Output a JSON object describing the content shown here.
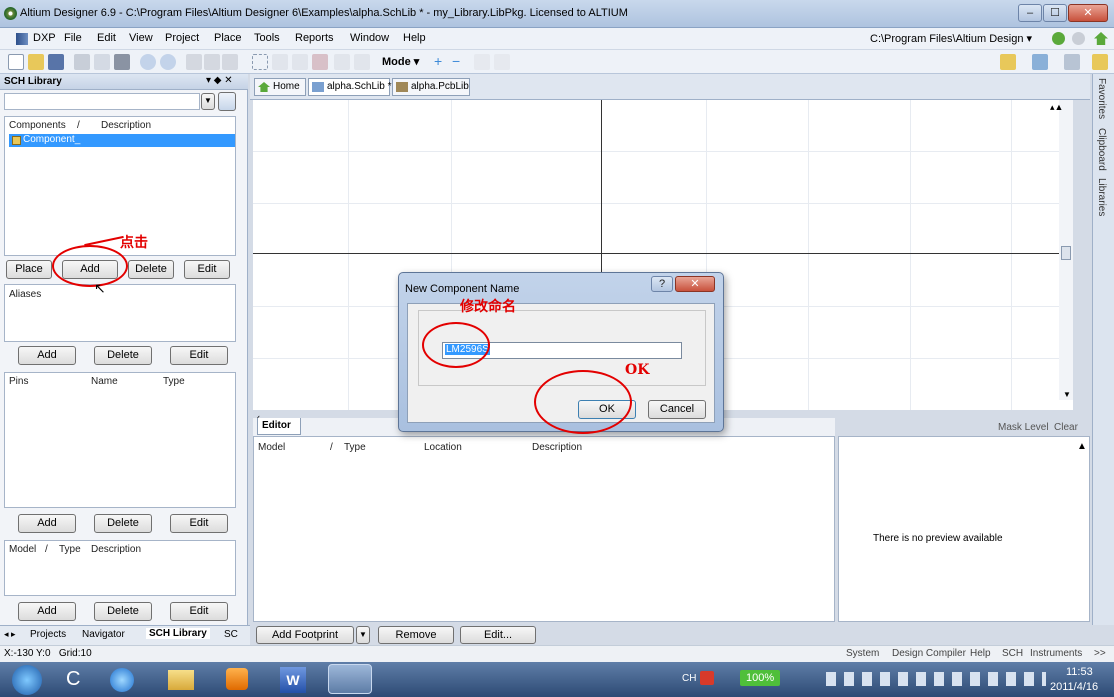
{
  "window": {
    "title": "Altium Designer 6.9 - C:\\Program Files\\Altium Designer 6\\Examples\\alpha.SchLib * - my_Library.LibPkg. Licensed to ALTIUM",
    "min": "–",
    "max": "☐",
    "close": "✕"
  },
  "menu": {
    "items": [
      "DXP",
      "File",
      "Edit",
      "View",
      "Project",
      "Place",
      "Tools",
      "Reports",
      "Window",
      "Help"
    ],
    "path_combo": "C:\\Program Files\\Altium Design ▾"
  },
  "toolbar": {
    "mode_label": "Mode ▾"
  },
  "sch_panel": {
    "title": "SCH Library",
    "components_header": [
      "Components",
      "/",
      "Description"
    ],
    "component_item": "Component_",
    "buttons1": [
      "Place",
      "Add",
      "Delete",
      "Edit"
    ],
    "aliases_header": "Aliases",
    "buttons2": [
      "Add",
      "Delete",
      "Edit"
    ],
    "pins_header": [
      "Pins",
      "Name",
      "Type"
    ],
    "buttons3": [
      "Add",
      "Delete",
      "Edit"
    ],
    "model_header": [
      "Model",
      "/",
      "Type",
      "Description"
    ],
    "buttons4": [
      "Add",
      "Delete",
      "Edit"
    ]
  },
  "doc_tabs": [
    "Home",
    "alpha.SchLib *",
    "alpha.PcbLib"
  ],
  "right_tabs": [
    "Favorites",
    "Clipboard",
    "Libraries"
  ],
  "editor": {
    "tab": "Editor",
    "columns": [
      "Model",
      "/",
      "Type",
      "Location",
      "Description"
    ],
    "buttons": [
      "Add Footprint",
      "Remove",
      "Edit..."
    ],
    "mask_level": "Mask Level",
    "clear": "Clear",
    "preview_text": "There is no preview available"
  },
  "dialog": {
    "title": "New Component Name",
    "help": "?",
    "close": "✕",
    "input_value": "LM2596S",
    "ok": "OK",
    "cancel": "Cancel"
  },
  "annotations": {
    "click": "点击",
    "rename": "修改命名",
    "ok": "OK"
  },
  "bottom_tabs": [
    "Projects",
    "Navigator",
    "SCH Library",
    "SC"
  ],
  "status": {
    "coords": "X:-130 Y:0   Grid:10",
    "right": [
      "System",
      "Design Compiler",
      "Help",
      "SCH",
      "Instruments",
      ">>"
    ]
  },
  "taskbar": {
    "ime": "CH",
    "zoom": "100%",
    "time": "11:53",
    "date": "2011/4/16"
  },
  "colors": {
    "annotation": "#e30000",
    "selection": "#3399ff"
  }
}
